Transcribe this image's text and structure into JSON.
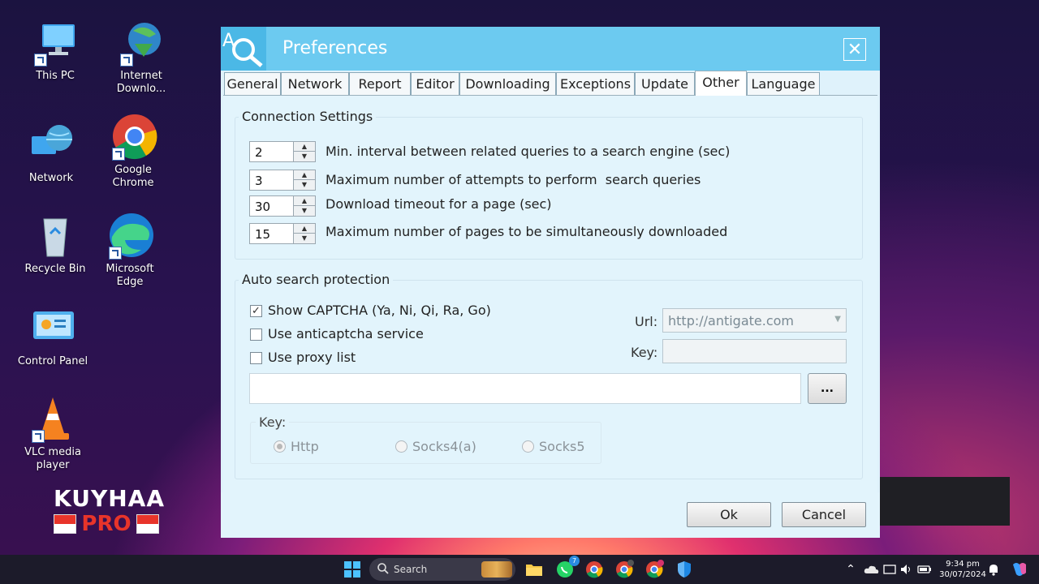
{
  "desktop": {
    "icons": [
      {
        "label": "This PC"
      },
      {
        "label": "Internet Downlo..."
      },
      {
        "label": "Network"
      },
      {
        "label": "Google Chrome"
      },
      {
        "label": "Recycle Bin"
      },
      {
        "label": "Microsoft Edge"
      },
      {
        "label": "Control Panel"
      },
      {
        "label": "VLC media player"
      }
    ],
    "watermark": {
      "line1": "KUYHAA",
      "line2": "PRO"
    }
  },
  "dialog": {
    "title": "Preferences",
    "tabs": [
      {
        "label": "General"
      },
      {
        "label": "Network"
      },
      {
        "label": "Report"
      },
      {
        "label": "Editor"
      },
      {
        "label": "Downloading"
      },
      {
        "label": "Exceptions"
      },
      {
        "label": "Update"
      },
      {
        "label": "Other",
        "active": true
      },
      {
        "label": "Language"
      }
    ],
    "connection": {
      "title": "Connection Settings",
      "rows": [
        {
          "value": "2",
          "label": "Min. interval between related queries to a search engine (sec)"
        },
        {
          "value": "3",
          "label": "Maximum number of attempts to perform  search queries"
        },
        {
          "value": "30",
          "label": "Download timeout for a page (sec)"
        },
        {
          "value": "15",
          "label": "Maximum number of pages to be simultaneously downloaded"
        }
      ]
    },
    "autosearch": {
      "title": "Auto search protection",
      "checkboxes": [
        {
          "label": "Show CAPTCHA (Ya, Ni, Qi, Ra, Go)",
          "checked": true
        },
        {
          "label": "Use anticaptcha service",
          "checked": false
        },
        {
          "label": "Use proxy list",
          "checked": false
        }
      ],
      "url_label": "Url:",
      "url_value": "http://antigate.com",
      "key_label": "Key:",
      "key_value": "",
      "proxy_path": "",
      "browse_label": "...",
      "proxy_type": {
        "title": "Key:",
        "options": [
          {
            "label": "Http",
            "selected": true
          },
          {
            "label": "Socks4(a)",
            "selected": false
          },
          {
            "label": "Socks5",
            "selected": false
          }
        ]
      }
    },
    "ok_label": "Ok",
    "cancel_label": "Cancel"
  },
  "taskbar": {
    "search_placeholder": "Search",
    "time": "9:34 pm",
    "date": "30/07/2024",
    "whatsapp_badge": "7"
  }
}
